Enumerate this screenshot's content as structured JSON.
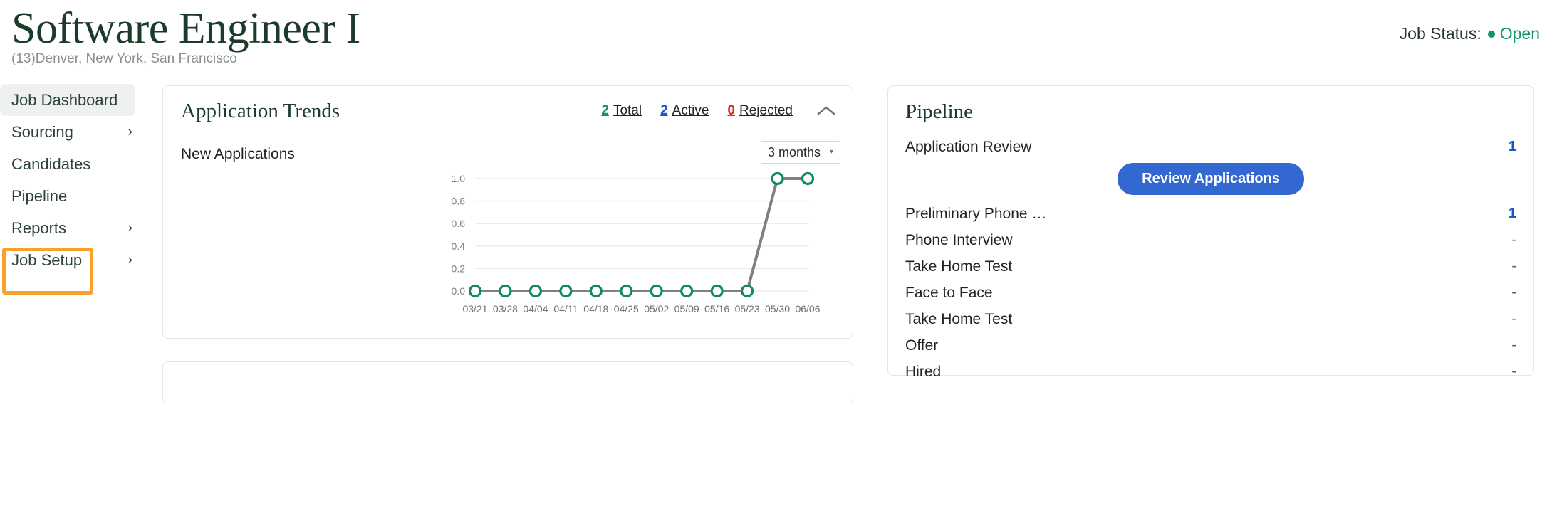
{
  "header": {
    "job_title": "Software Engineer I",
    "subtitle": "(13)Denver, New York, San Francisco",
    "status_label": "Job Status:",
    "status_value": "Open",
    "status_color": "#12936b"
  },
  "sidebar": {
    "items": [
      {
        "label": "Job Dashboard",
        "chevron": "",
        "active": true
      },
      {
        "label": "Sourcing",
        "chevron": "›",
        "active": false
      },
      {
        "label": "Candidates",
        "chevron": "",
        "active": false
      },
      {
        "label": "Pipeline",
        "chevron": "",
        "active": false
      },
      {
        "label": "Reports",
        "chevron": "›",
        "active": false
      },
      {
        "label": "Job Setup",
        "chevron": "›",
        "active": false
      }
    ],
    "highlight_color": "#f9a22b",
    "highlighted_item": "Pipeline"
  },
  "trends": {
    "title": "Application Trends",
    "stats": [
      {
        "value": "2",
        "label": "Total",
        "color": "#12936b"
      },
      {
        "value": "2",
        "label": "Active",
        "color": "#1757c8"
      },
      {
        "value": "0",
        "label": "Rejected",
        "color": "#e02b20"
      }
    ],
    "collapse_icon": "chevron-up-icon",
    "series_label": "New Applications",
    "range_value": "3 months",
    "range_caret": "▾"
  },
  "chart_data": {
    "type": "line",
    "title": "New Applications",
    "xlabel": "",
    "ylabel": "",
    "x": [
      "03/21",
      "03/28",
      "04/04",
      "04/11",
      "04/18",
      "04/25",
      "05/02",
      "05/09",
      "05/16",
      "05/23",
      "05/30",
      "06/06"
    ],
    "series": [
      {
        "name": "New Applications",
        "values": [
          0,
          0,
          0,
          0,
          0,
          0,
          0,
          0,
          0,
          0,
          1,
          1
        ]
      }
    ],
    "yticks": [
      "0.0",
      "0.2",
      "0.4",
      "0.6",
      "0.8",
      "1.0"
    ],
    "ylim": [
      0,
      1.0
    ],
    "grid": true,
    "legend": "none",
    "line_color": "#808080",
    "marker_color": "#0e8a5f",
    "marker_style": "open-circle"
  },
  "pipeline": {
    "title": "Pipeline",
    "review_button": "Review Applications",
    "stages": [
      {
        "label": "Application Review",
        "count": "1",
        "highlight": true
      },
      {
        "label": "Preliminary Phone …",
        "count": "1",
        "highlight": true
      },
      {
        "label": "Phone Interview",
        "count": "-",
        "highlight": false
      },
      {
        "label": "Take Home Test",
        "count": "-",
        "highlight": false
      },
      {
        "label": "Face to Face",
        "count": "-",
        "highlight": false
      },
      {
        "label": "Take Home Test",
        "count": "-",
        "highlight": false
      },
      {
        "label": "Offer",
        "count": "-",
        "highlight": false
      },
      {
        "label": "Hired",
        "count": "-",
        "highlight": false
      }
    ]
  }
}
